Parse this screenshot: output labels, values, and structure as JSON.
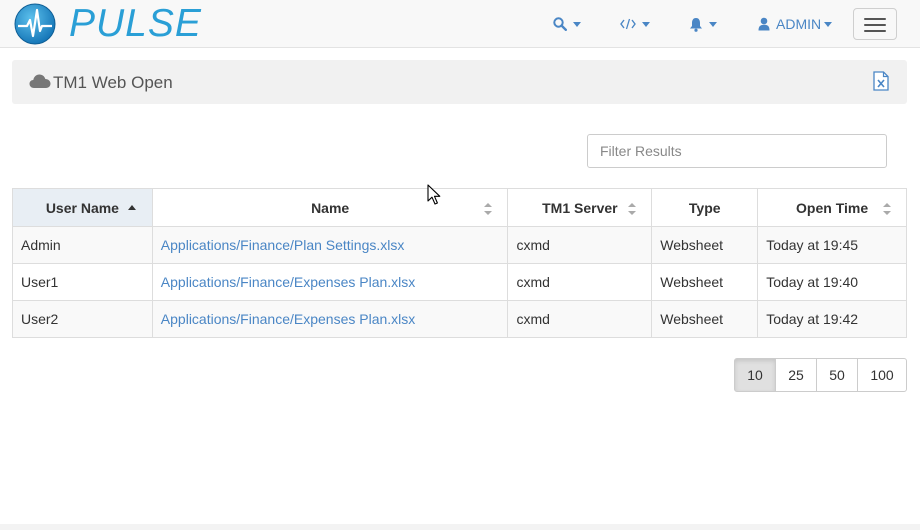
{
  "app": {
    "brand": "PULSE"
  },
  "nav": {
    "search_icon": "search-icon",
    "code_icon": "code-icon",
    "bell_icon": "bell-icon",
    "user": "ADMIN"
  },
  "panel": {
    "title": "TM1 Web Open"
  },
  "filter": {
    "placeholder": "Filter Results",
    "value": ""
  },
  "table": {
    "columns": [
      "User Name",
      "Name",
      "TM1 Server",
      "Type",
      "Open Time"
    ],
    "rows": [
      [
        "Admin",
        "Applications/Finance/Plan Settings.xlsx",
        "cxmd",
        "Websheet",
        "Today at 19:45"
      ],
      [
        "User1",
        "Applications/Finance/Expenses Plan.xlsx",
        "cxmd",
        "Websheet",
        "Today at 19:40"
      ],
      [
        "User2",
        "Applications/Finance/Expenses Plan.xlsx",
        "cxmd",
        "Websheet",
        "Today at 19:42"
      ]
    ]
  },
  "pagination": {
    "sizes": [
      "10",
      "25",
      "50",
      "100"
    ],
    "selected": "10"
  },
  "colors": {
    "accent": "#2a9fd6",
    "link": "#4a86c5"
  }
}
